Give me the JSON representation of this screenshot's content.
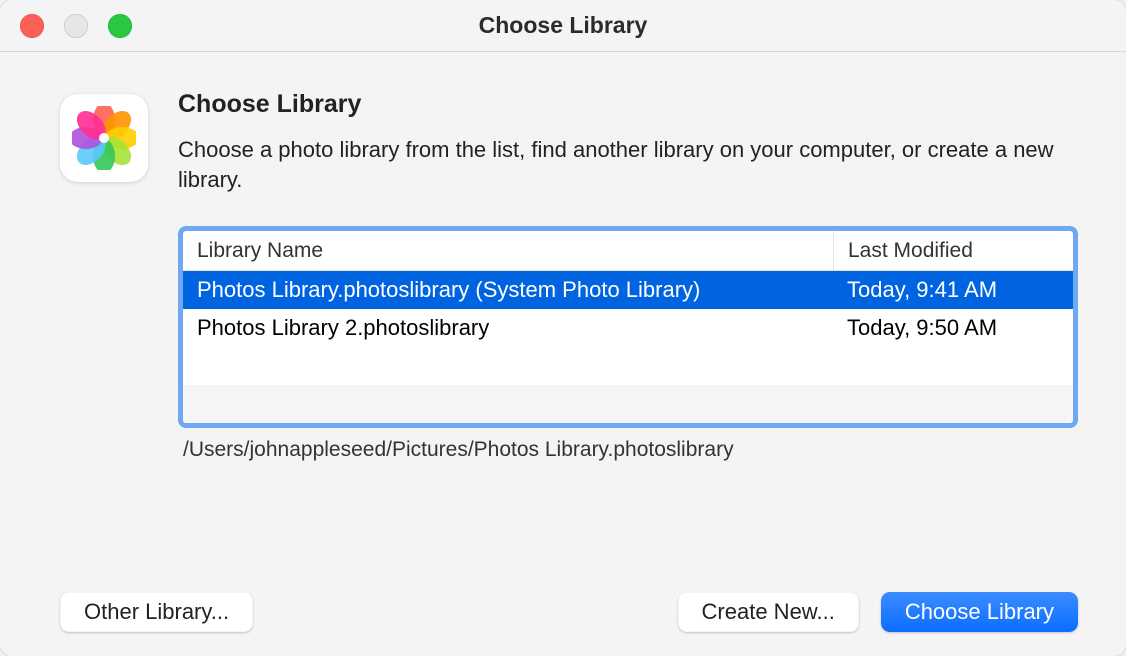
{
  "window": {
    "title": "Choose Library"
  },
  "main": {
    "heading": "Choose Library",
    "description": "Choose a photo library from the list, find another library on your computer, or create a new library."
  },
  "table": {
    "header_name": "Library Name",
    "header_date": "Last Modified",
    "rows": [
      {
        "name": "Photos Library.photoslibrary (System Photo Library)",
        "date": "Today, 9:41 AM",
        "selected": true
      },
      {
        "name": "Photos Library 2.photoslibrary",
        "date": "Today, 9:50 AM",
        "selected": false
      }
    ],
    "selected_path": "/Users/johnappleseed/Pictures/Photos Library.photoslibrary"
  },
  "buttons": {
    "other": "Other Library...",
    "create": "Create New...",
    "choose": "Choose Library"
  }
}
